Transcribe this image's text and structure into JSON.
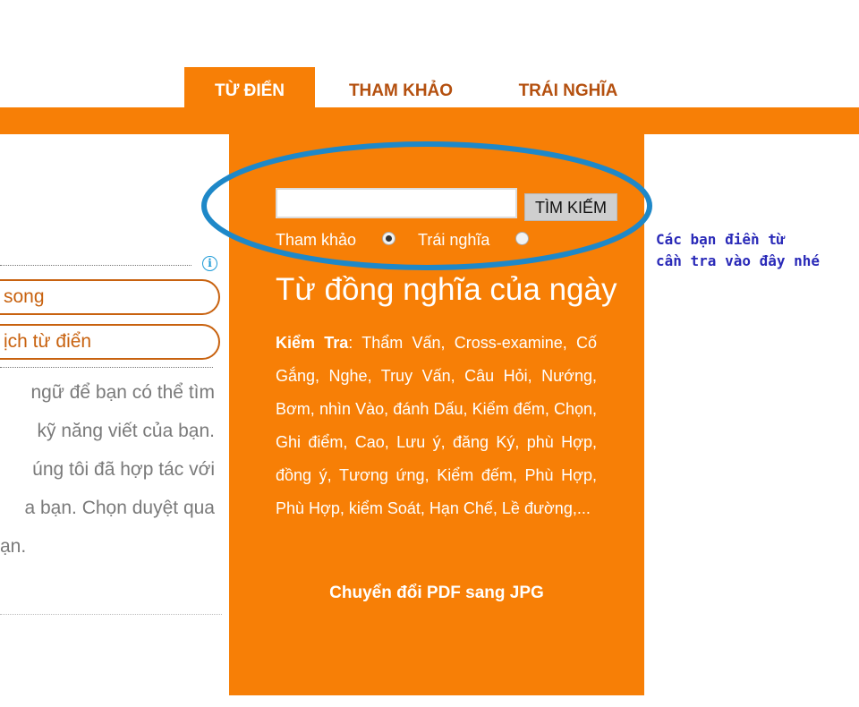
{
  "tabs": [
    {
      "label": "TỪ ĐIỂN",
      "active": true
    },
    {
      "label": "THAM KHẢO",
      "active": false
    },
    {
      "label": "TRÁI NGHĨA",
      "active": false
    }
  ],
  "search": {
    "input_value": "",
    "button_label": "TÌM KIẾM",
    "options": [
      {
        "label": "Tham khảo",
        "selected": true
      },
      {
        "label": "Trái nghĩa",
        "selected": false
      }
    ]
  },
  "annotation": {
    "line1": "Các bạn điền từ",
    "line2": "cần tra vào đây nhé",
    "color": "#2a2ab8",
    "ellipse_color": "#1e88c8"
  },
  "word_of_day": {
    "title": "Từ đồng nghĩa của ngày",
    "term": "Kiểm Tra",
    "synonyms": ": Thẩm Vấn, Cross-examine, Cố Gắng, Nghe, Truy Vấn, Câu Hỏi, Nướng, Bơm, nhìn Vào, đánh Dấu, Kiểm đếm, Chọn, Ghi điểm, Cao, Lưu ý, đăng Ký, phù Hợp, đồng ý, Tương ứng, Kiểm đếm, Phù Hợp, Phù Hợp, kiểm Soát, Hạn Chế, Lề đường,..."
  },
  "pdf_link": "Chuyển đổi PDF sang JPG",
  "left_panel": {
    "pill1": "song",
    "pill2": "ịch từ điển",
    "paragraph": [
      "ngữ để bạn có thể tìm",
      "kỹ năng viết của bạn.",
      "úng tôi đã hợp tác với",
      "a bạn. Chọn duyệt qua",
      "ạn."
    ],
    "info_icon": "info-icon"
  },
  "colors": {
    "accent": "#f77f06",
    "tab_text": "#b4500f",
    "pill_border": "#c8620f"
  }
}
